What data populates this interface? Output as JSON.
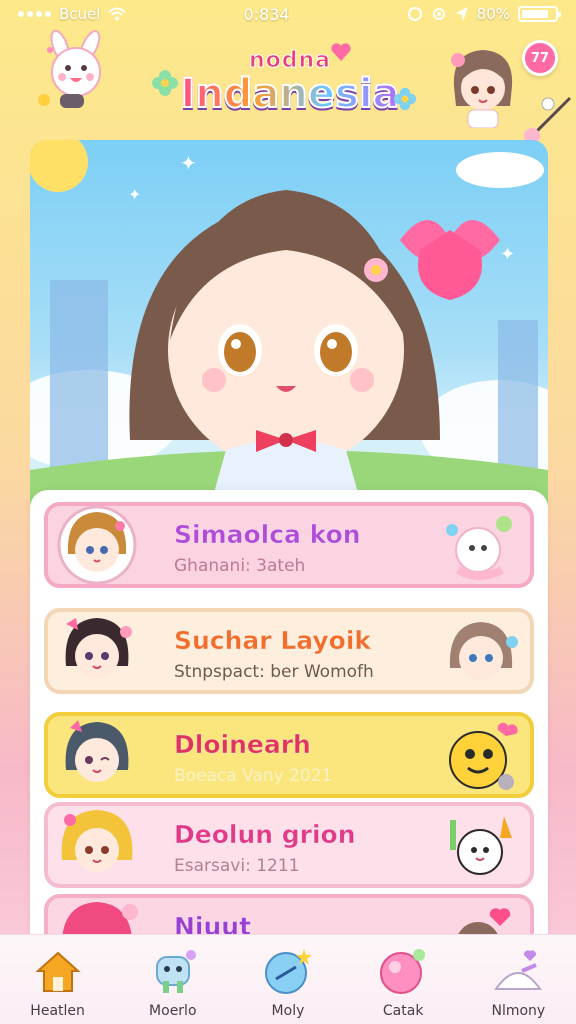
{
  "status_bar": {
    "carrier": "Bcuel",
    "time": "0:834",
    "battery": "80%",
    "battery_level": 0.8
  },
  "header": {
    "logo_small": "nodna",
    "logo_big": "Indanesia",
    "notification_count": "77"
  },
  "list": {
    "items": [
      {
        "title": "Simaolca kon",
        "subtitle": "Ghanani: 3ateh"
      },
      {
        "title": "Suchar Layoik",
        "subtitle": "Stnpspact: ber Womofh"
      },
      {
        "title": "Dloinearh",
        "subtitle": "Boeaca Vany 2021"
      },
      {
        "title": "Deolun grion",
        "subtitle": "Esarsavi: 1211"
      },
      {
        "title": "Niuut",
        "subtitle": ""
      }
    ]
  },
  "nav": {
    "items": [
      {
        "label": "Heatlen",
        "icon": "home-icon"
      },
      {
        "label": "Moerlo",
        "icon": "character-icon"
      },
      {
        "label": "Moly",
        "icon": "star-orb-icon"
      },
      {
        "label": "Catak",
        "icon": "bubble-icon"
      },
      {
        "label": "Nlmony",
        "icon": "heart-hill-icon"
      }
    ]
  },
  "colors": {
    "accent_pink": "#ff6aa5",
    "nav_home_orange": "#f5a623",
    "card_pink": "#fbd3e1",
    "card_yellow": "#fbe67d"
  }
}
